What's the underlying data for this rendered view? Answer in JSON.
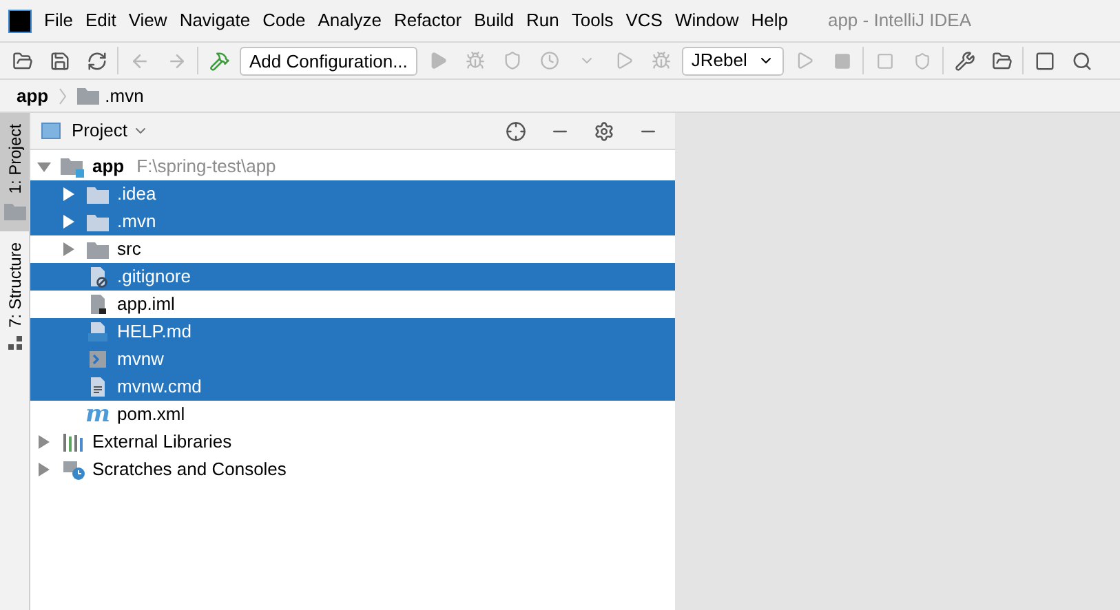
{
  "menu_bar": {
    "items": [
      "File",
      "Edit",
      "View",
      "Navigate",
      "Code",
      "Analyze",
      "Refactor",
      "Build",
      "Run",
      "Tools",
      "VCS",
      "Window",
      "Help"
    ],
    "title": "app - IntelliJ IDEA"
  },
  "toolbar": {
    "run_config": "Add Configuration...",
    "jrebel": "JRebel"
  },
  "breadcrumb": [
    {
      "label": "app",
      "kind": "project"
    },
    {
      "label": ".mvn",
      "kind": "folder"
    }
  ],
  "tool_strip": [
    {
      "label": "1: Project",
      "selected": true,
      "kind": "folder"
    },
    {
      "label": "7: Structure",
      "selected": false,
      "kind": "structure"
    }
  ],
  "project_panel": {
    "title": "Project",
    "tree": [
      {
        "label": "app",
        "path": "F:\\spring-test\\app",
        "kind": "module",
        "expanded": true,
        "selected": false,
        "children": [
          {
            "label": ".idea",
            "kind": "folder",
            "expanded": false,
            "selected": true
          },
          {
            "label": ".mvn",
            "kind": "folder",
            "expanded": false,
            "selected": true
          },
          {
            "label": "src",
            "kind": "folder",
            "expanded": false,
            "selected": false
          },
          {
            "label": ".gitignore",
            "kind": "ignore",
            "selected": true
          },
          {
            "label": "app.iml",
            "kind": "iml",
            "selected": false
          },
          {
            "label": "HELP.md",
            "kind": "markdown",
            "selected": true
          },
          {
            "label": "mvnw",
            "kind": "shell",
            "selected": true
          },
          {
            "label": "mvnw.cmd",
            "kind": "text",
            "selected": true
          },
          {
            "label": "pom.xml",
            "kind": "maven",
            "icon": "m",
            "selected": false
          }
        ]
      },
      {
        "label": "External Libraries",
        "kind": "libraries",
        "expanded": false,
        "selected": false
      },
      {
        "label": "Scratches and Consoles",
        "kind": "scratches",
        "expanded": false,
        "selected": false
      }
    ]
  }
}
